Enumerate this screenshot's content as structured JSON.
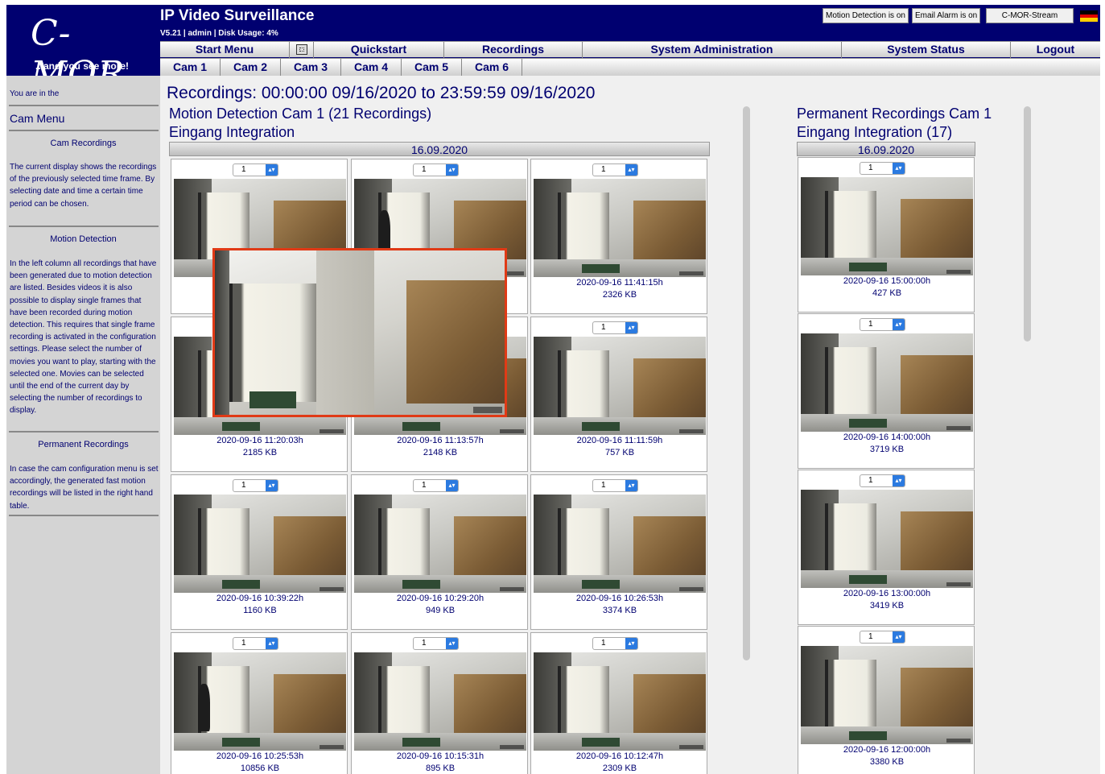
{
  "header": {
    "logo_text": "C-MOR",
    "logo_tagline": "...and you see more!",
    "title": "IP Video Surveillance",
    "subtitle": "V5.21 | admin | Disk Usage: 4%",
    "motion_detection_btn": "Motion Detection is on",
    "email_alarm_btn": "Email Alarm is on",
    "stream_btn": "C-MOR-Stream",
    "flag_colors": [
      "#000000",
      "#dd0000",
      "#ffce00"
    ]
  },
  "nav": {
    "start_menu": "Start Menu",
    "fullscreen_icon": "fullscreen-icon",
    "quickstart": "Quickstart",
    "recordings": "Recordings",
    "system_administration": "System Administration",
    "system_status": "System Status",
    "logout": "Logout"
  },
  "cam_tabs": [
    "Cam 1",
    "Cam 2",
    "Cam 3",
    "Cam 4",
    "Cam 5",
    "Cam 6"
  ],
  "sidebar": {
    "you_are_in": "You are in the",
    "menu_title": "Cam Menu",
    "sections": [
      {
        "heading": "Cam Recordings",
        "text": "The current display shows the recordings of the previously selected time frame. By selecting date and time a certain time period can be chosen."
      },
      {
        "heading": "Motion Detection",
        "text": "In the left column all recordings that have been generated due to motion detection are listed. Besides videos it is also possible to display single frames that have been recorded during motion detection. This requires that single frame recording is activated in the configuration settings. Please select the number of movies you want to play, starting with the selected one. Movies can be selected until the end of the current day by selecting the number of recordings to display."
      },
      {
        "heading": "Permanent Recordings",
        "text": "In case the cam configuration menu is set accordingly, the generated fast motion recordings will be listed in the right hand table."
      }
    ]
  },
  "main": {
    "page_title": "Recordings: 00:00:00 09/16/2020 to 23:59:59 09/16/2020",
    "motion_title": "Motion Detection Cam 1 (21 Recordings)",
    "motion_subtitle": "Eingang Integration",
    "motion_date": "16.09.2020",
    "permanent_title": "Permanent Recordings Cam 1",
    "permanent_subtitle": "Eingang Integration (17)",
    "permanent_date": "16.09.2020",
    "select_value": "1",
    "motion_recordings": [
      {
        "time": "",
        "size": "",
        "person": false
      },
      {
        "time": "",
        "size": "",
        "person": true
      },
      {
        "time": "2020-09-16 11:41:15h",
        "size": "2326 KB",
        "person": false
      },
      {
        "time": "2020-09-16 11:20:03h",
        "size": "2185 KB",
        "person": false
      },
      {
        "time": "2020-09-16 11:13:57h",
        "size": "2148 KB",
        "person": false
      },
      {
        "time": "2020-09-16 11:11:59h",
        "size": "757 KB",
        "person": false
      },
      {
        "time": "2020-09-16 10:39:22h",
        "size": "1160 KB",
        "person": false
      },
      {
        "time": "2020-09-16 10:29:20h",
        "size": "949 KB",
        "person": false
      },
      {
        "time": "2020-09-16 10:26:53h",
        "size": "3374 KB",
        "person": false
      },
      {
        "time": "2020-09-16 10:25:53h",
        "size": "10856 KB",
        "person": true
      },
      {
        "time": "2020-09-16 10:15:31h",
        "size": "895 KB",
        "person": false
      },
      {
        "time": "2020-09-16 10:12:47h",
        "size": "2309 KB",
        "person": false
      }
    ],
    "permanent_recordings": [
      {
        "time": "2020-09-16 15:00:00h",
        "size": "427 KB"
      },
      {
        "time": "2020-09-16 14:00:00h",
        "size": "3719 KB"
      },
      {
        "time": "2020-09-16 13:00:00h",
        "size": "3419 KB"
      },
      {
        "time": "2020-09-16 12:00:00h",
        "size": "3380 KB"
      }
    ],
    "preview_border_color": "#e03a16"
  }
}
